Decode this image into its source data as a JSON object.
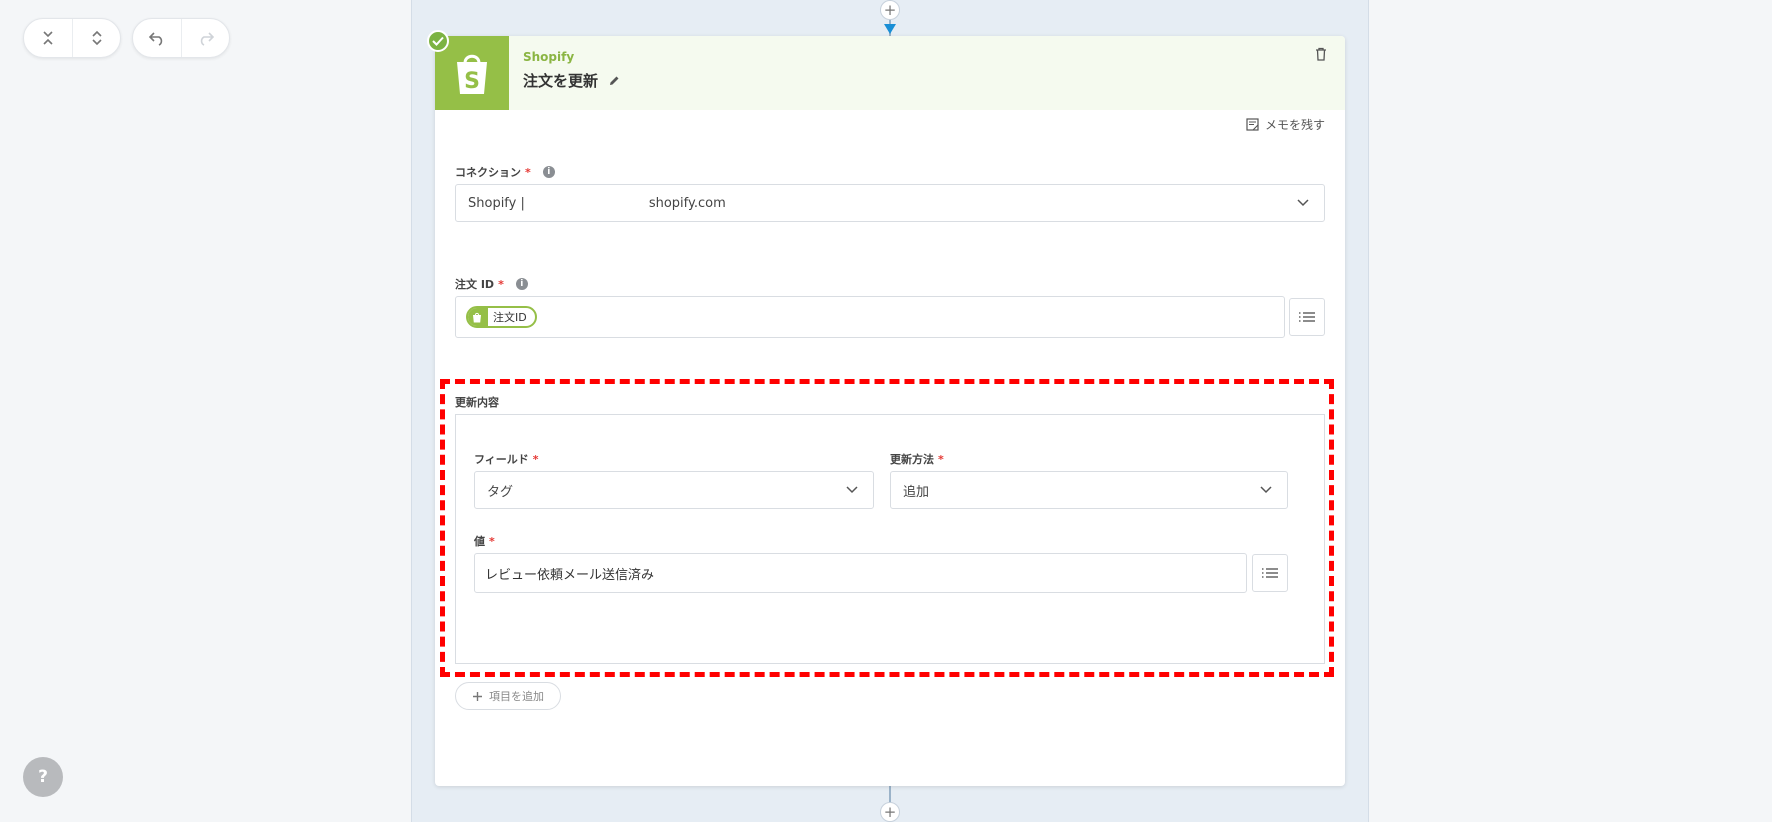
{
  "colors": {
    "brand": "#95bf47",
    "highlight": "#ff0000",
    "required": "#e53935"
  },
  "toolbar": {
    "icons": [
      "collapse-all-icon",
      "expand-all-icon",
      "undo-icon",
      "redo-icon"
    ],
    "help_label": "?"
  },
  "card": {
    "app_name": "Shopify",
    "action_title": "注文を更新",
    "memo_label": "メモを残す"
  },
  "connection": {
    "label": "コネクション",
    "value": "Shopify |                              shopify.com"
  },
  "order_id": {
    "label": "注文 ID",
    "chip_label": "注文ID"
  },
  "update_section": {
    "title": "更新内容",
    "field_label": "フィールド",
    "field_value": "タグ",
    "method_label": "更新方法",
    "method_value": "追加",
    "value_label": "値",
    "value_text": "レビュー依頼メール送信済み"
  },
  "add_item_label": "項目を追加",
  "required_mark": "*"
}
